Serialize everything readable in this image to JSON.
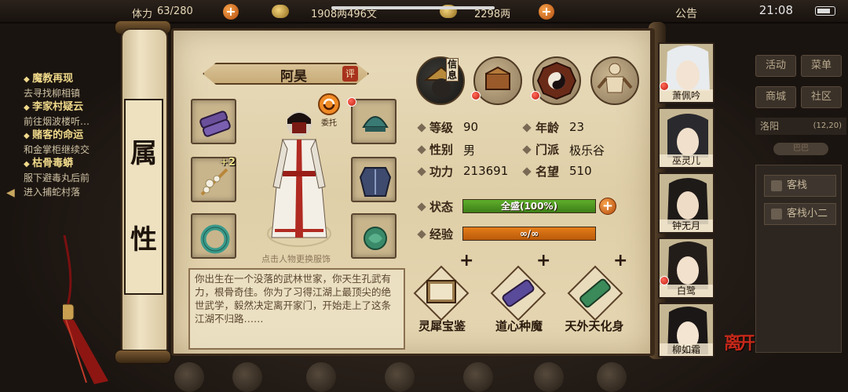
{
  "topbar": {
    "stamina_label": "体力",
    "stamina": "63/280",
    "money": "1908两496文",
    "gold": "2298两",
    "notice": "公告",
    "time": "21:08"
  },
  "quests": [
    {
      "title": "魔教再现",
      "desc": "去寻找柳相镇"
    },
    {
      "title": "李家村疑云",
      "desc": "前往烟波楼听…"
    },
    {
      "title": "赌客的命运",
      "desc": "和金掌柜继续交"
    },
    {
      "title": "枯骨毒蟒",
      "desc": "服下避毒丸后前"
    },
    {
      "title": "",
      "desc": "进入捕蛇村落"
    }
  ],
  "right_menu": {
    "activity": "活动",
    "menu": "菜单",
    "shop": "商城",
    "community": "社区",
    "location": "洛阳",
    "coords": "(12,20)",
    "sub_location": "巴巴",
    "inn": "客栈",
    "inn_waiter": "客栈小二"
  },
  "scroll": {
    "char1": "属",
    "char2": "性"
  },
  "character": {
    "name": "阿昊",
    "rate_badge": "评",
    "entrust_label": "委托",
    "enhance_badge": "+2",
    "change_outfit_hint": "点击人物更换服饰",
    "bio": "你出生在一个没落的武林世家，你天生孔武有力，根骨奇佳。你为了习得江湖上最顶尖的绝世武学，毅然决定离开家门，开始走上了这条江湖不归路……"
  },
  "tabs": {
    "info_label": "信息"
  },
  "stats": {
    "level_label": "等级",
    "level": "90",
    "age_label": "年龄",
    "age": "23",
    "gender_label": "性别",
    "gender": "男",
    "sect_label": "门派",
    "sect": "极乐谷",
    "power_label": "功力",
    "power": "213691",
    "fame_label": "名望",
    "fame": "510",
    "status_label": "状态",
    "status_text": "全盛(100%)",
    "status_fraction": 1.0,
    "exp_label": "经验",
    "exp_text": "∞/∞",
    "exp_fraction": 1.0
  },
  "skills": [
    {
      "name": "灵犀宝鉴",
      "plus": "+"
    },
    {
      "name": "道心种魔",
      "plus": "+"
    },
    {
      "name": "天外天化身",
      "plus": "+"
    }
  ],
  "companions": [
    {
      "name": "萧佩吟"
    },
    {
      "name": "巫灵儿"
    },
    {
      "name": "钟无月"
    },
    {
      "name": "白鹭"
    },
    {
      "name": "柳如霜"
    }
  ],
  "leave_button": "离开",
  "bottom_icons": [
    "角色",
    "包裹",
    "武学",
    "市集",
    "技艺",
    "纪事",
    "地图"
  ],
  "colors": {
    "status_bar": "#5fae2c",
    "exp_bar": "#e57d1a",
    "accent_plus": "#e07a22",
    "notification": "#d42414"
  }
}
